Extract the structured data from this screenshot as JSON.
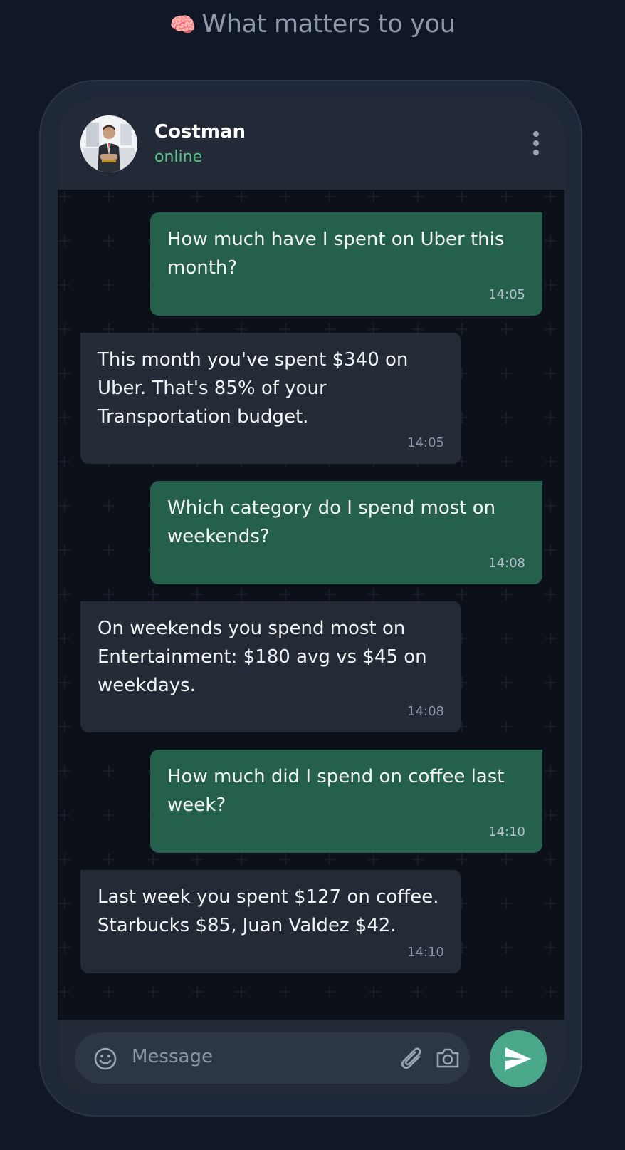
{
  "page": {
    "heading_emoji": "🧠",
    "heading_text": "What matters to you"
  },
  "contact": {
    "name": "Costman",
    "status": "online",
    "status_color": "#5dc38a"
  },
  "messages": [
    {
      "direction": "outgoing",
      "text": "How much have I spent on Uber this month?",
      "time": "14:05"
    },
    {
      "direction": "incoming",
      "text": "This month you've spent $340 on Uber. That's 85% of your Transportation budget.",
      "time": "14:05"
    },
    {
      "direction": "outgoing",
      "text": "Which category do I spend most on weekends?",
      "time": "14:08"
    },
    {
      "direction": "incoming",
      "text": "On weekends you spend most on Entertainment: $180 avg vs $45 on weekdays.",
      "time": "14:08"
    },
    {
      "direction": "outgoing",
      "text": "How much did I spend on coffee last week?",
      "time": "14:10"
    },
    {
      "direction": "incoming",
      "text": "Last week you spent $127 on coffee. Starbucks $85, Juan Valdez $42.",
      "time": "14:10"
    }
  ],
  "composer": {
    "placeholder": "Message",
    "icons": [
      "emoji-icon",
      "paperclip-icon",
      "camera-icon",
      "send-icon"
    ]
  },
  "colors": {
    "background": "#101828",
    "outgoing_bubble": "#25604c",
    "incoming_bubble": "#222b36",
    "send_button": "#4aa98b"
  }
}
